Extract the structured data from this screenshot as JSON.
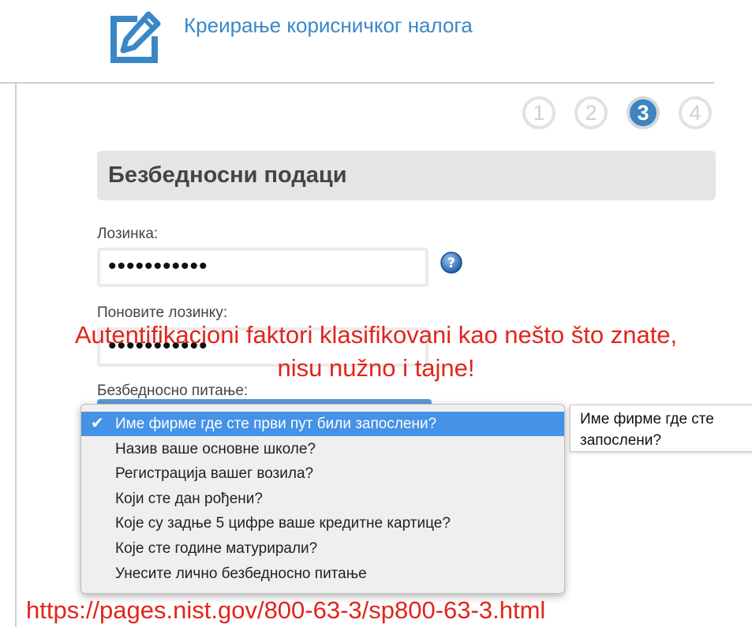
{
  "header": {
    "title": "Креирање корисничког налога",
    "icon": "edit-icon",
    "accent_color": "#3a87c8"
  },
  "steps": [
    {
      "label": "1",
      "active": false
    },
    {
      "label": "2",
      "active": false
    },
    {
      "label": "3",
      "active": true
    },
    {
      "label": "4",
      "active": false
    }
  ],
  "section": {
    "title": "Безбедносни подаци"
  },
  "password": {
    "label": "Лозинка:",
    "value": "•••••••••••"
  },
  "repeat_password": {
    "label": "Поновите лозинку:",
    "value": "•••••••••••"
  },
  "security_question": {
    "label": "Безбедносно питање:",
    "selected_color": "#4592e6",
    "options": [
      "Име фирме где сте први пут били запослени?",
      "Назив ваше основне школе?",
      "Регистрација вашег возила?",
      "Који сте дан рођени?",
      "Које су задње 5 цифре ваше кредитне картице?",
      "Које сте године матурирали?",
      "Унесите лично безбедносно питање"
    ],
    "selected_index": 0,
    "check_mark": "✔"
  },
  "tooltip": {
    "text": "Име фирме где сте запослени?"
  },
  "overlay": {
    "caption_line1": "Autentifikacioni faktori klasifikovani kao nešto što znate,",
    "caption_line2": "nisu nužno i tajne!",
    "url": "https://pages.nist.gov/800-63-3/sp800-63-3.html",
    "color": "#e1251b"
  }
}
